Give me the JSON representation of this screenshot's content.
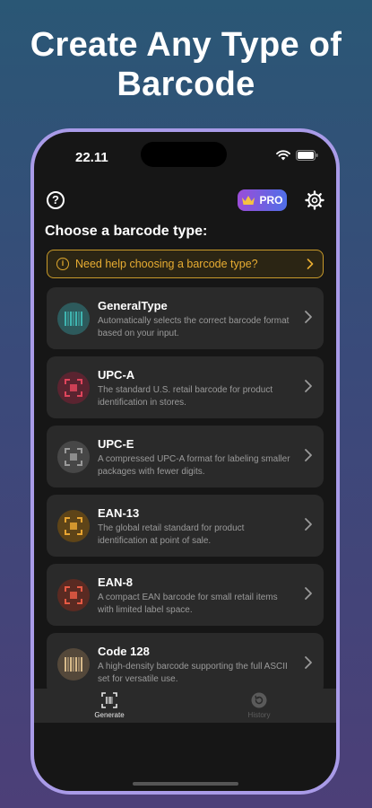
{
  "promo": {
    "headline_line1": "Create Any Type of",
    "headline_line2": "Barcode"
  },
  "status_bar": {
    "time": "22.11"
  },
  "top_bar": {
    "help_glyph": "?",
    "pro_label": "PRO"
  },
  "section_title": "Choose a barcode type:",
  "help_banner": {
    "text": "Need help choosing a barcode type?"
  },
  "barcode_types": [
    {
      "name": "GeneralType",
      "description": "Automatically selects the correct barcode format based on your input.",
      "icon": "barcode-icon",
      "color": "#3fb4b0",
      "bg": "#2d5a5c"
    },
    {
      "name": "UPC-A",
      "description": "The standard U.S. retail barcode for product identification in stores.",
      "icon": "scan-frame-icon",
      "color": "#e0455c",
      "bg": "#5a2430"
    },
    {
      "name": "UPC-E",
      "description": "A compressed UPC-A format for labeling smaller packages with fewer digits.",
      "icon": "scan-frame-icon",
      "color": "#9a9a9a",
      "bg": "#474747"
    },
    {
      "name": "EAN-13",
      "description": "The global retail standard for product identification at point of sale.",
      "icon": "scan-frame-icon",
      "color": "#e8a532",
      "bg": "#5e4418"
    },
    {
      "name": "EAN-8",
      "description": "A compact EAN barcode for small retail items with limited label space.",
      "icon": "scan-frame-icon",
      "color": "#e65a44",
      "bg": "#5a2a22"
    },
    {
      "name": "Code 128",
      "description": "A high-density barcode supporting the full ASCII set for versatile use.",
      "icon": "barcode-icon",
      "color": "#d6b98a",
      "bg": "#54483a"
    }
  ],
  "tab_bar": {
    "generate_label": "Generate",
    "history_label": "History"
  }
}
